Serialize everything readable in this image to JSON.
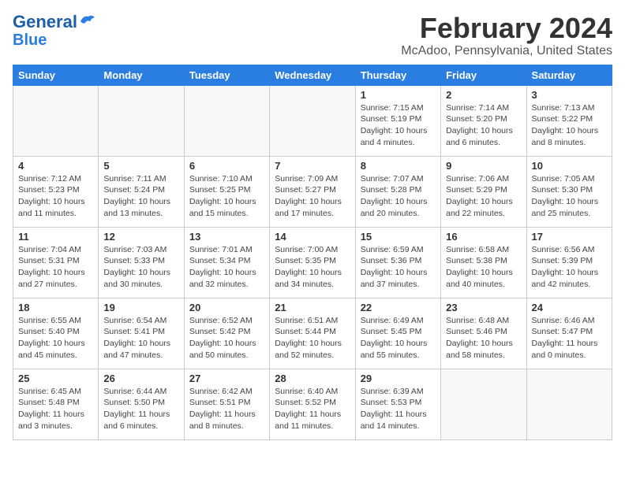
{
  "header": {
    "logo_line1": "General",
    "logo_line2": "Blue",
    "month": "February 2024",
    "location": "McAdoo, Pennsylvania, United States"
  },
  "days_of_week": [
    "Sunday",
    "Monday",
    "Tuesday",
    "Wednesday",
    "Thursday",
    "Friday",
    "Saturday"
  ],
  "weeks": [
    [
      {
        "day": "",
        "info": ""
      },
      {
        "day": "",
        "info": ""
      },
      {
        "day": "",
        "info": ""
      },
      {
        "day": "",
        "info": ""
      },
      {
        "day": "1",
        "info": "Sunrise: 7:15 AM\nSunset: 5:19 PM\nDaylight: 10 hours\nand 4 minutes."
      },
      {
        "day": "2",
        "info": "Sunrise: 7:14 AM\nSunset: 5:20 PM\nDaylight: 10 hours\nand 6 minutes."
      },
      {
        "day": "3",
        "info": "Sunrise: 7:13 AM\nSunset: 5:22 PM\nDaylight: 10 hours\nand 8 minutes."
      }
    ],
    [
      {
        "day": "4",
        "info": "Sunrise: 7:12 AM\nSunset: 5:23 PM\nDaylight: 10 hours\nand 11 minutes."
      },
      {
        "day": "5",
        "info": "Sunrise: 7:11 AM\nSunset: 5:24 PM\nDaylight: 10 hours\nand 13 minutes."
      },
      {
        "day": "6",
        "info": "Sunrise: 7:10 AM\nSunset: 5:25 PM\nDaylight: 10 hours\nand 15 minutes."
      },
      {
        "day": "7",
        "info": "Sunrise: 7:09 AM\nSunset: 5:27 PM\nDaylight: 10 hours\nand 17 minutes."
      },
      {
        "day": "8",
        "info": "Sunrise: 7:07 AM\nSunset: 5:28 PM\nDaylight: 10 hours\nand 20 minutes."
      },
      {
        "day": "9",
        "info": "Sunrise: 7:06 AM\nSunset: 5:29 PM\nDaylight: 10 hours\nand 22 minutes."
      },
      {
        "day": "10",
        "info": "Sunrise: 7:05 AM\nSunset: 5:30 PM\nDaylight: 10 hours\nand 25 minutes."
      }
    ],
    [
      {
        "day": "11",
        "info": "Sunrise: 7:04 AM\nSunset: 5:31 PM\nDaylight: 10 hours\nand 27 minutes."
      },
      {
        "day": "12",
        "info": "Sunrise: 7:03 AM\nSunset: 5:33 PM\nDaylight: 10 hours\nand 30 minutes."
      },
      {
        "day": "13",
        "info": "Sunrise: 7:01 AM\nSunset: 5:34 PM\nDaylight: 10 hours\nand 32 minutes."
      },
      {
        "day": "14",
        "info": "Sunrise: 7:00 AM\nSunset: 5:35 PM\nDaylight: 10 hours\nand 34 minutes."
      },
      {
        "day": "15",
        "info": "Sunrise: 6:59 AM\nSunset: 5:36 PM\nDaylight: 10 hours\nand 37 minutes."
      },
      {
        "day": "16",
        "info": "Sunrise: 6:58 AM\nSunset: 5:38 PM\nDaylight: 10 hours\nand 40 minutes."
      },
      {
        "day": "17",
        "info": "Sunrise: 6:56 AM\nSunset: 5:39 PM\nDaylight: 10 hours\nand 42 minutes."
      }
    ],
    [
      {
        "day": "18",
        "info": "Sunrise: 6:55 AM\nSunset: 5:40 PM\nDaylight: 10 hours\nand 45 minutes."
      },
      {
        "day": "19",
        "info": "Sunrise: 6:54 AM\nSunset: 5:41 PM\nDaylight: 10 hours\nand 47 minutes."
      },
      {
        "day": "20",
        "info": "Sunrise: 6:52 AM\nSunset: 5:42 PM\nDaylight: 10 hours\nand 50 minutes."
      },
      {
        "day": "21",
        "info": "Sunrise: 6:51 AM\nSunset: 5:44 PM\nDaylight: 10 hours\nand 52 minutes."
      },
      {
        "day": "22",
        "info": "Sunrise: 6:49 AM\nSunset: 5:45 PM\nDaylight: 10 hours\nand 55 minutes."
      },
      {
        "day": "23",
        "info": "Sunrise: 6:48 AM\nSunset: 5:46 PM\nDaylight: 10 hours\nand 58 minutes."
      },
      {
        "day": "24",
        "info": "Sunrise: 6:46 AM\nSunset: 5:47 PM\nDaylight: 11 hours\nand 0 minutes."
      }
    ],
    [
      {
        "day": "25",
        "info": "Sunrise: 6:45 AM\nSunset: 5:48 PM\nDaylight: 11 hours\nand 3 minutes."
      },
      {
        "day": "26",
        "info": "Sunrise: 6:44 AM\nSunset: 5:50 PM\nDaylight: 11 hours\nand 6 minutes."
      },
      {
        "day": "27",
        "info": "Sunrise: 6:42 AM\nSunset: 5:51 PM\nDaylight: 11 hours\nand 8 minutes."
      },
      {
        "day": "28",
        "info": "Sunrise: 6:40 AM\nSunset: 5:52 PM\nDaylight: 11 hours\nand 11 minutes."
      },
      {
        "day": "29",
        "info": "Sunrise: 6:39 AM\nSunset: 5:53 PM\nDaylight: 11 hours\nand 14 minutes."
      },
      {
        "day": "",
        "info": ""
      },
      {
        "day": "",
        "info": ""
      }
    ]
  ]
}
